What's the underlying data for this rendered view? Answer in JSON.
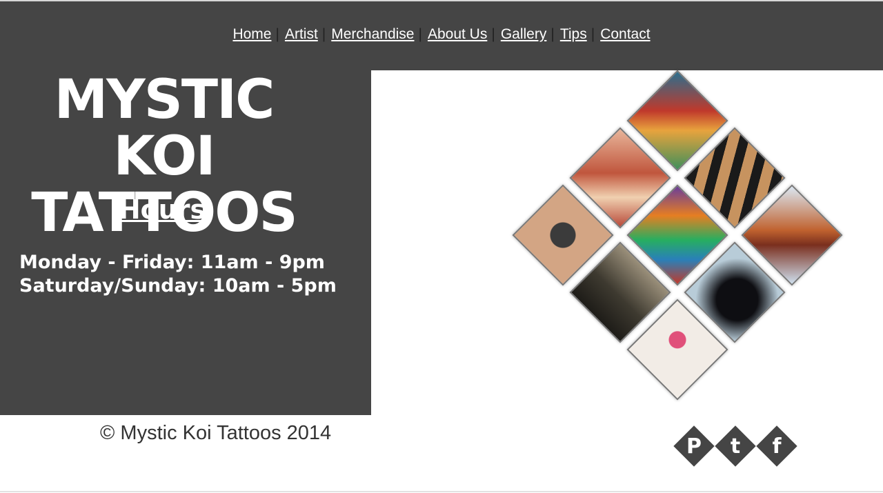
{
  "nav": {
    "items": [
      {
        "label": "Home"
      },
      {
        "label": "Artist"
      },
      {
        "label": "Merchandise"
      },
      {
        "label": "About Us"
      },
      {
        "label": "Gallery"
      },
      {
        "label": "Tips"
      },
      {
        "label": "Contact"
      }
    ],
    "separator": "|"
  },
  "logo": {
    "line1": "MYSTIC KOI",
    "line2": "TATTOOS"
  },
  "hours": {
    "title": "Hours",
    "lines": [
      "Monday - Friday: 11am - 9pm",
      "Saturday/Sunday: 10am - 5pm"
    ]
  },
  "gallery": {
    "images": [
      {
        "name": "gallery-tile-abstract-color"
      },
      {
        "name": "gallery-tile-koi"
      },
      {
        "name": "gallery-tile-tribal"
      },
      {
        "name": "gallery-tile-kanji"
      },
      {
        "name": "gallery-tile-owl"
      },
      {
        "name": "gallery-tile-fox"
      },
      {
        "name": "gallery-tile-street-scene"
      },
      {
        "name": "gallery-tile-raven"
      },
      {
        "name": "gallery-tile-flowers"
      }
    ]
  },
  "footer": {
    "copyright": "© Mystic Koi Tattoos 2014"
  },
  "social": [
    {
      "name": "pinterest-icon",
      "glyph": "P"
    },
    {
      "name": "twitter-icon",
      "glyph": "t"
    },
    {
      "name": "facebook-icon",
      "glyph": "f"
    }
  ],
  "colors": {
    "header_bg": "#454545",
    "text_light": "#ffffff",
    "separator": "#222222"
  }
}
